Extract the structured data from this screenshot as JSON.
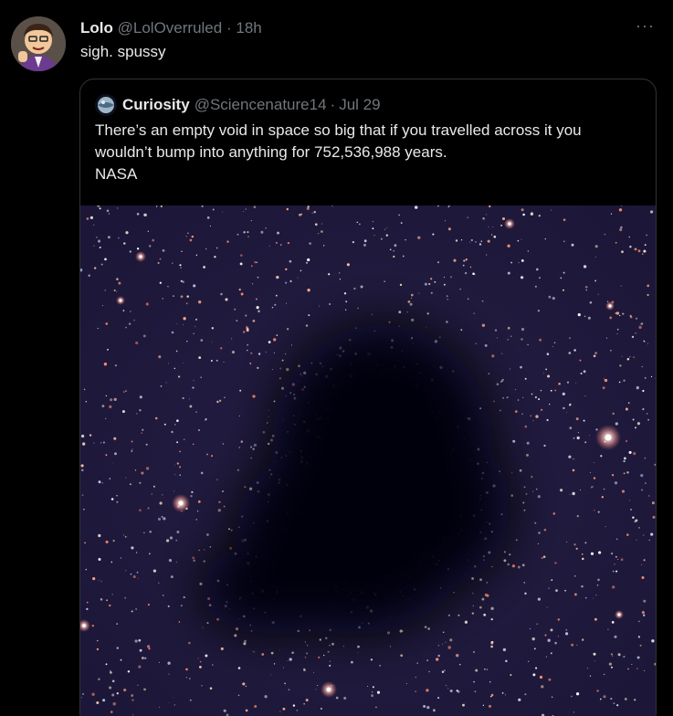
{
  "tweet": {
    "author_name": "Lolo",
    "author_handle": "@LolOverruled",
    "separator": "·",
    "time": "18h",
    "text": "sigh. spussy",
    "more_icon": "more-icon",
    "avatar_icon": "avatar-cartoon"
  },
  "quote": {
    "author_name": "Curiosity",
    "author_handle": "@Sciencenature14",
    "separator": "·",
    "time": "Jul 29",
    "text_lines": [
      "There’s an empty void in space so big that if you travelled across it you",
      "wouldn’t bump into anything for 752,536,988 years.",
      "NASA"
    ],
    "media_description": "starfield-dark-nebula-image"
  },
  "colors": {
    "background": "#000000",
    "text_primary": "#e7e9ea",
    "text_secondary": "#71767b",
    "border": "#2f3336"
  }
}
